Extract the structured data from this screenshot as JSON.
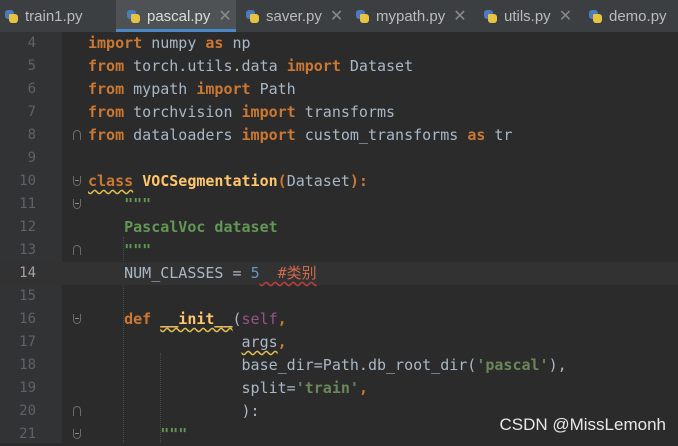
{
  "tabs": [
    {
      "label": "train1.py",
      "active": false
    },
    {
      "label": "pascal.py",
      "active": true
    },
    {
      "label": "saver.py",
      "active": false
    },
    {
      "label": "mypath.py",
      "active": false
    },
    {
      "label": "utils.py",
      "active": false
    },
    {
      "label": "demo.py",
      "active": false
    }
  ],
  "editor": {
    "current_line": "14",
    "lines": [
      {
        "n": "4",
        "t": [
          "import",
          " numpy ",
          "as",
          " np"
        ]
      },
      {
        "n": "5",
        "t": [
          "from",
          " torch.utils.data ",
          "import",
          " Dataset"
        ]
      },
      {
        "n": "6",
        "t": [
          "from",
          " mypath ",
          "import",
          " Path"
        ]
      },
      {
        "n": "7",
        "t": [
          "from",
          " torchvision ",
          "import",
          " transforms"
        ]
      },
      {
        "n": "8",
        "t": [
          "from",
          " dataloaders ",
          "import",
          " custom_transforms ",
          "as",
          " tr"
        ]
      },
      {
        "n": "9",
        "t": []
      },
      {
        "n": "10",
        "t": [
          "class",
          " ",
          "VOCSegmentation",
          "(",
          "Dataset",
          "):"
        ]
      },
      {
        "n": "11",
        "t": [
          "    \"\"\""
        ]
      },
      {
        "n": "12",
        "t": [
          "    PascalVoc dataset"
        ]
      },
      {
        "n": "13",
        "t": [
          "    \"\"\""
        ]
      },
      {
        "n": "14",
        "t": [
          "    NUM_CLASSES = ",
          "5",
          "  #类别"
        ]
      },
      {
        "n": "15",
        "t": []
      },
      {
        "n": "16",
        "t": [
          "    ",
          "def",
          " ",
          "__init__",
          "(",
          "self",
          ","
        ]
      },
      {
        "n": "17",
        "t": [
          "                 ",
          "args",
          ","
        ]
      },
      {
        "n": "18",
        "t": [
          "                 base_dir=Path.db_root_dir(",
          "'pascal'",
          "),"
        ]
      },
      {
        "n": "19",
        "t": [
          "                 split=",
          "'train'",
          ","
        ]
      },
      {
        "n": "20",
        "t": [
          "                 ):"
        ]
      },
      {
        "n": "21",
        "t": [
          "        \"\"\""
        ]
      }
    ]
  },
  "watermark": "CSDN @MissLemonh"
}
